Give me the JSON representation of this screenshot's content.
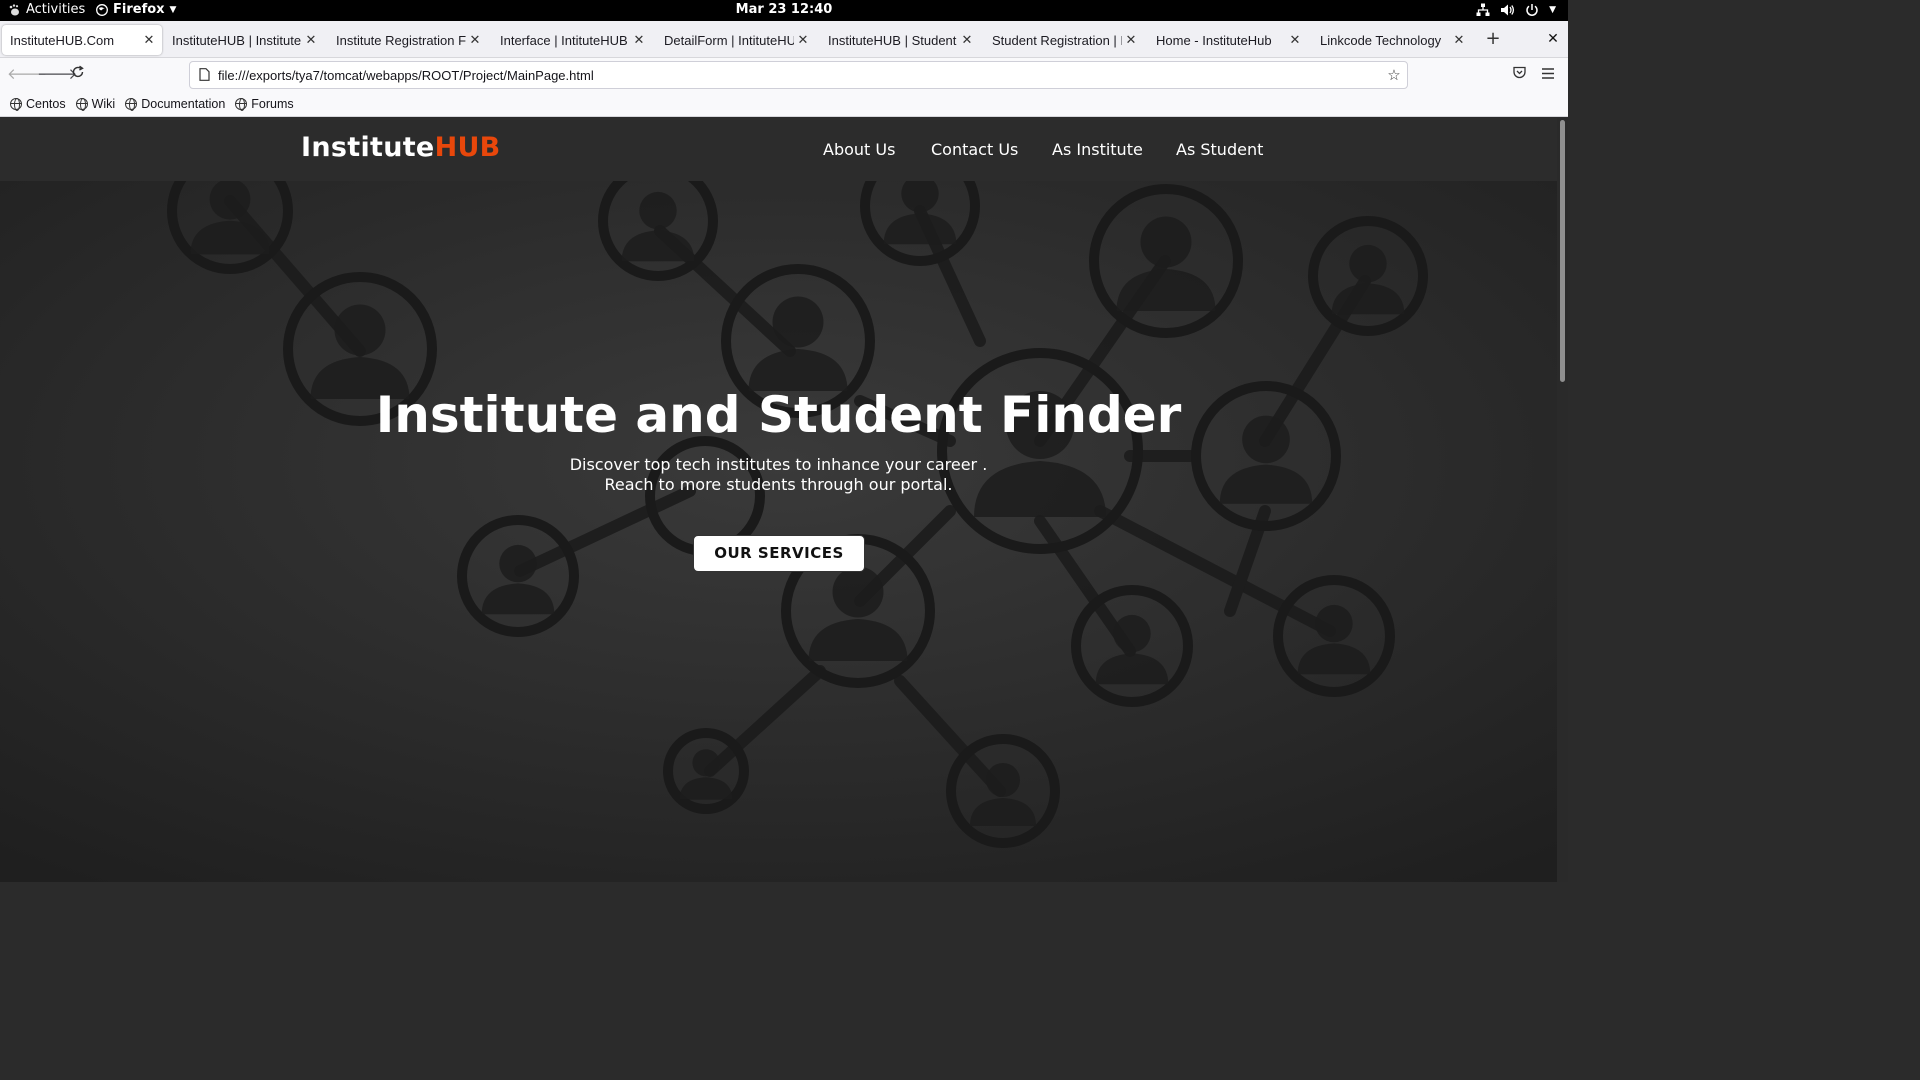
{
  "system_bar": {
    "activities": "Activities",
    "app_menu": "Firefox",
    "clock": "Mar 23  12:40",
    "icons": [
      "network-icon",
      "volume-icon",
      "power-icon"
    ]
  },
  "tabs": [
    {
      "title": "InstituteHUB.Com",
      "active": true
    },
    {
      "title": "InstituteHUB | Institute",
      "active": false
    },
    {
      "title": "Institute Registration Form",
      "active": false
    },
    {
      "title": "Interface | IntituteHUB",
      "active": false
    },
    {
      "title": "DetailForm | IntituteHUB",
      "active": false
    },
    {
      "title": "InstituteHUB | Student",
      "active": false
    },
    {
      "title": "Student Registration | Institute",
      "active": false
    },
    {
      "title": "Home - InstituteHub",
      "active": false
    },
    {
      "title": "Linkcode Technology",
      "active": false
    }
  ],
  "navigation": {
    "url": "file:///exports/tya7/tomcat/webapps/ROOT/Project/MainPage.html"
  },
  "bookmarks": [
    "Centos",
    "Wiki",
    "Documentation",
    "Forums"
  ],
  "site": {
    "logo_main": "Institute",
    "logo_accent": "HUB",
    "accent_color": "#e8470b",
    "nav": [
      "About Us",
      "Contact Us",
      "As Institute",
      "As Student"
    ],
    "hero_title": "Institute and Student Finder",
    "hero_line1": "Discover top tech institutes to inhance your career .",
    "hero_line2": "Reach to more students through our portal.",
    "cta": "OUR SERVICES"
  }
}
